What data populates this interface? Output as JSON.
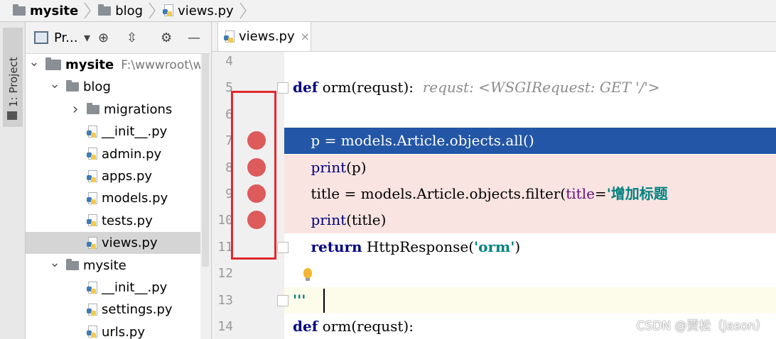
{
  "breadcrumb": [
    {
      "label": "mysite",
      "icon": "folder-icon",
      "bold": true
    },
    {
      "label": "blog",
      "icon": "folder-icon",
      "bold": false
    },
    {
      "label": "views.py",
      "icon": "python-file-icon",
      "bold": false
    }
  ],
  "side_strip": {
    "label": "1: Project"
  },
  "project_panel": {
    "toolbar_label": "Pr...",
    "toolbar_icons": [
      "dropdown-arrow-icon",
      "locate-icon",
      "collapse-icon",
      "gear-icon",
      "minimize-icon"
    ],
    "tree": [
      {
        "name": "mysite",
        "path": "F:\\wwwroot\\we",
        "arrow": "v",
        "type": "folder",
        "indent": 0,
        "bold": true
      },
      {
        "name": "blog",
        "arrow": "v",
        "type": "folder",
        "indent": 1
      },
      {
        "name": "migrations",
        "arrow": ">",
        "type": "folder",
        "indent": 2
      },
      {
        "name": "__init__.py",
        "type": "py",
        "indent": 2
      },
      {
        "name": "admin.py",
        "type": "py",
        "indent": 2
      },
      {
        "name": "apps.py",
        "type": "py",
        "indent": 2
      },
      {
        "name": "models.py",
        "type": "py",
        "indent": 2
      },
      {
        "name": "tests.py",
        "type": "py",
        "indent": 2
      },
      {
        "name": "views.py",
        "type": "py",
        "indent": 2,
        "selected": true
      },
      {
        "name": "mysite",
        "arrow": "v",
        "type": "folder",
        "indent": 1
      },
      {
        "name": "__init__.py",
        "type": "py",
        "indent": 2
      },
      {
        "name": "settings.py",
        "type": "py",
        "indent": 2
      },
      {
        "name": "urls.py",
        "type": "py",
        "indent": 2
      }
    ]
  },
  "editor": {
    "tab": {
      "label": "views.py",
      "close": "×"
    },
    "lines": [
      {
        "num": "4",
        "html": ""
      },
      {
        "num": "5",
        "html": "<span class=\"kw\">def</span> orm(<span>requst</span>):  <span class=\"hint\">requst: &lt;WSGIRequest: GET '/'&gt;</span>",
        "fold": true
      },
      {
        "num": "6",
        "html": ""
      },
      {
        "num": "7",
        "html": "    p = models.Article.objects.all()",
        "style": "hl",
        "breakpoint": true
      },
      {
        "num": "8",
        "html": "    <span class=\"kw\" style=\"font-weight:normal\">print</span>(p)",
        "style": "bp",
        "breakpoint": true
      },
      {
        "num": "9",
        "html": "    title = models.Article.objects.filter(<span class=\"paramc\">title</span>=<span class=\"str\">'增加标题</span>",
        "style": "bp",
        "breakpoint": true
      },
      {
        "num": "10",
        "html": "    <span class=\"kw\" style=\"font-weight:normal\">print</span>(title)",
        "style": "bp",
        "breakpoint": true
      },
      {
        "num": "11",
        "html": "    <span class=\"kw\">return</span> HttpResponse(<span class=\"str\">'orm'</span>)",
        "fold": true
      },
      {
        "num": "12",
        "html": ""
      },
      {
        "num": "13",
        "html": "<span class=\"str\">'''</span>",
        "style": "cur",
        "fold": true
      },
      {
        "num": "14",
        "html": "<span class=\"kw\">def</span> orm(requst):"
      }
    ],
    "highlight_color": "#2356a6",
    "breakpoint_color": "#dd5b5b",
    "annotation_box_color": "#e0282e"
  },
  "watermark": "CSDN @贾松（Jason）"
}
